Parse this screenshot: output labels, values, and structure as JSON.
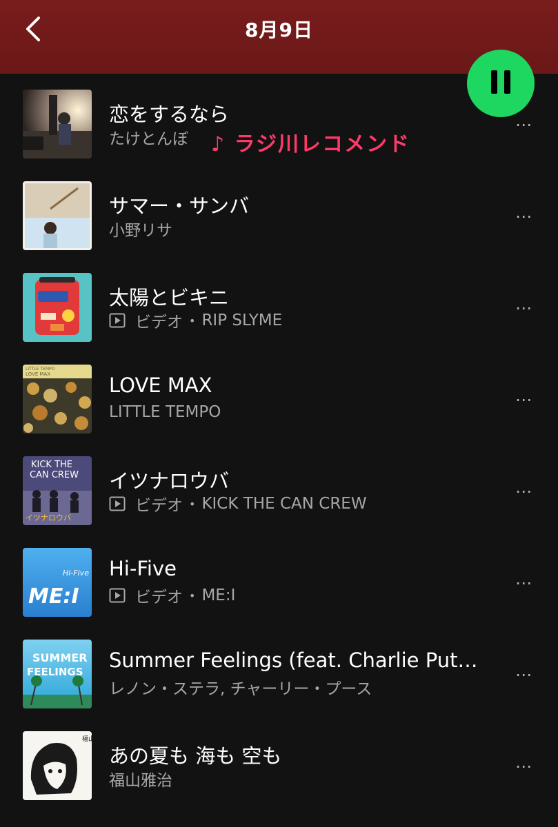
{
  "header": {
    "title": "8月9日"
  },
  "overlay": {
    "caption": "♪ ラジ川レコメンド"
  },
  "icons": {
    "back": "chevron-left-icon",
    "pause": "pause-icon",
    "more": "more-horizontal-icon",
    "video": "video-icon"
  },
  "colors": {
    "header_bg": "#7a1c1c",
    "accent": "#1ed760",
    "caption": "#ff3a6a"
  },
  "tracks": [
    {
      "title": "恋をするなら",
      "artist": "たけとんぼ",
      "video": false,
      "video_label": "",
      "more": "⋯"
    },
    {
      "title": "サマー・サンバ",
      "artist": "小野リサ",
      "video": false,
      "video_label": "",
      "more": "⋯"
    },
    {
      "title": "太陽とビキニ",
      "artist": "RIP SLYME",
      "video": true,
      "video_label": "ビデオ",
      "more": "⋯"
    },
    {
      "title": "LOVE MAX",
      "artist": "LITTLE TEMPO",
      "video": false,
      "video_label": "",
      "more": "⋯"
    },
    {
      "title": "イツナロウバ",
      "artist": "KICK THE CAN CREW",
      "video": true,
      "video_label": "ビデオ",
      "more": "⋯"
    },
    {
      "title": "Hi-Five",
      "artist": "ME:I",
      "video": true,
      "video_label": "ビデオ",
      "more": "⋯"
    },
    {
      "title": "Summer Feelings (feat. Charlie Puth...",
      "artist": "レノン・ステラ, チャーリー・プース",
      "video": false,
      "video_label": "",
      "more": "⋯"
    },
    {
      "title": "あの夏も 海も 空も",
      "artist": "福山雅治",
      "video": false,
      "video_label": "",
      "more": "⋯"
    }
  ],
  "art_text": {
    "t4_a": "LITTLE TEMPO",
    "t4_b": "LOVE MAX",
    "t5_a": "KICK THE",
    "t5_b": "CAN CREW",
    "t5_c": "イツナロウバ",
    "t6_a": "Hi-Five",
    "t6_b": "ME:I",
    "t7_a": "SUMMER",
    "t7_b": "FEELINGS",
    "t8_a": "福山雅治"
  }
}
